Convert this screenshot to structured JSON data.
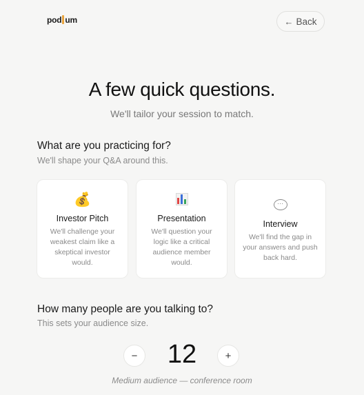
{
  "header": {
    "logo_left": "pod",
    "logo_right": "um",
    "back_label": "Back",
    "back_icon": "arrow-left-icon"
  },
  "hero": {
    "title": "A few quick questions.",
    "subtitle": "We'll tailor your session to match."
  },
  "practice": {
    "title": "What are you practicing for?",
    "subtitle": "We'll shape your Q&A around this.",
    "options": [
      {
        "icon": "money-bag-icon",
        "icon_glyph": "💰",
        "name": "Investor Pitch",
        "desc": "We'll challenge your weakest claim like a skeptical investor would."
      },
      {
        "icon": "bar-chart-icon",
        "name": "Presentation",
        "desc": "We'll question your logic like a critical audience member would."
      },
      {
        "icon": "speech-bubble-icon",
        "icon_glyph": "···",
        "name": "Interview",
        "desc": "We'll find the gap in your answers and push back hard."
      }
    ]
  },
  "audience": {
    "title": "How many people are you talking to?",
    "subtitle": "This sets your audience size.",
    "decrement_label": "−",
    "increment_label": "+",
    "count": "12",
    "caption": "Medium audience — conference room"
  },
  "colors": {
    "background": "#f6f6f5",
    "accent": "#e8a33c",
    "card": "#ffffff",
    "muted_text": "#8a8a8a"
  }
}
